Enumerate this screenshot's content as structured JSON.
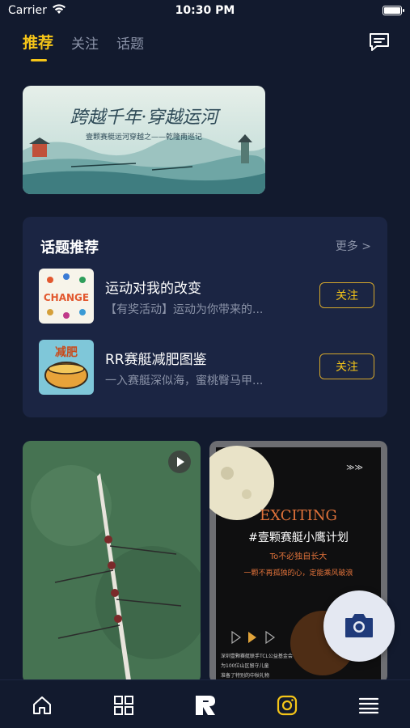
{
  "status": {
    "carrier": "Carrier",
    "time": "10:30 PM"
  },
  "tabs": [
    {
      "label": "推荐",
      "active": true
    },
    {
      "label": "关注",
      "active": false
    },
    {
      "label": "话题",
      "active": false
    }
  ],
  "banner": {
    "title": "跨越千年·穿越运河",
    "subtitle": "壹颗赛艇运河穿越之——乾隆南巡记"
  },
  "topics": {
    "title": "话题推荐",
    "more": "更多 >",
    "items": [
      {
        "name": "运动对我的改变",
        "desc": "【有奖活动】运动为你带来的...",
        "button": "关注",
        "thumb_text": "CHANGE"
      },
      {
        "name": "RR赛艇减肥图鉴",
        "desc": "一入赛艇深似海，蜜桃臀马甲...",
        "button": "关注",
        "thumb_text": "减肥"
      }
    ]
  },
  "posts": {
    "right": {
      "headline": "EXCITING",
      "title": "#壹颗赛艇小鹰计划",
      "line1": "To不必独自长大",
      "line2": "一颗不再孤独的心，定能乘风破浪",
      "caption1": "深圳壹颗赛艇联手TCL公益基金会",
      "caption2": "为100位山区留守儿童",
      "caption3": "准备了特别的中秋礼物"
    }
  },
  "icons": {
    "tabbar": [
      "home-icon",
      "grid-icon",
      "rr-logo-icon",
      "instagram-icon",
      "menu-icon"
    ],
    "fab": "camera-icon"
  },
  "colors": {
    "accent": "#f5c518",
    "background": "#121a2e",
    "card": "#1b2543",
    "muted": "#8b93a8"
  }
}
